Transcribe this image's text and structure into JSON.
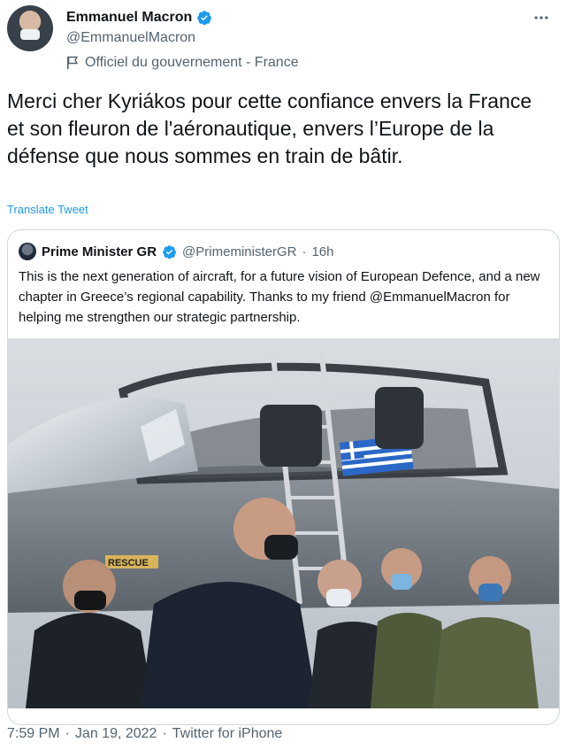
{
  "author": {
    "name": "Emmanuel Macron",
    "handle": "@EmmanuelMacron",
    "label": "Officiel du gouvernement - France",
    "verified": true
  },
  "tweet": {
    "text": "Merci cher Kyriákos pour cette confiance envers la France et son fleuron de l'aéronautique, envers l’Europe de la défense que nous sommes en train de bâtir.",
    "translate_label": "Translate Tweet"
  },
  "quoted": {
    "name": "Prime Minister GR",
    "handle": "@PrimeministerGR",
    "separator": "·",
    "age": "16h",
    "text": "This is the next generation of aircraft, for a future vision of European Defence, and a new chapter in Greece’s regional capability. Thanks to my friend @EmmanuelMacron for helping me strengthen our strategic partnership.",
    "image_text": "RESCUE"
  },
  "footer": {
    "time": "7:59 PM",
    "sep1": "·",
    "date": "Jan 19, 2022",
    "sep2": "·",
    "client": "Twitter for iPhone"
  },
  "icons": {
    "verified": "verified-badge-icon",
    "label": "government-flag-icon",
    "more": "more-options-icon"
  },
  "colors": {
    "text": "#0f1419",
    "secondary": "#536471",
    "link": "#1d9bf0",
    "border": "#cfd9de"
  }
}
